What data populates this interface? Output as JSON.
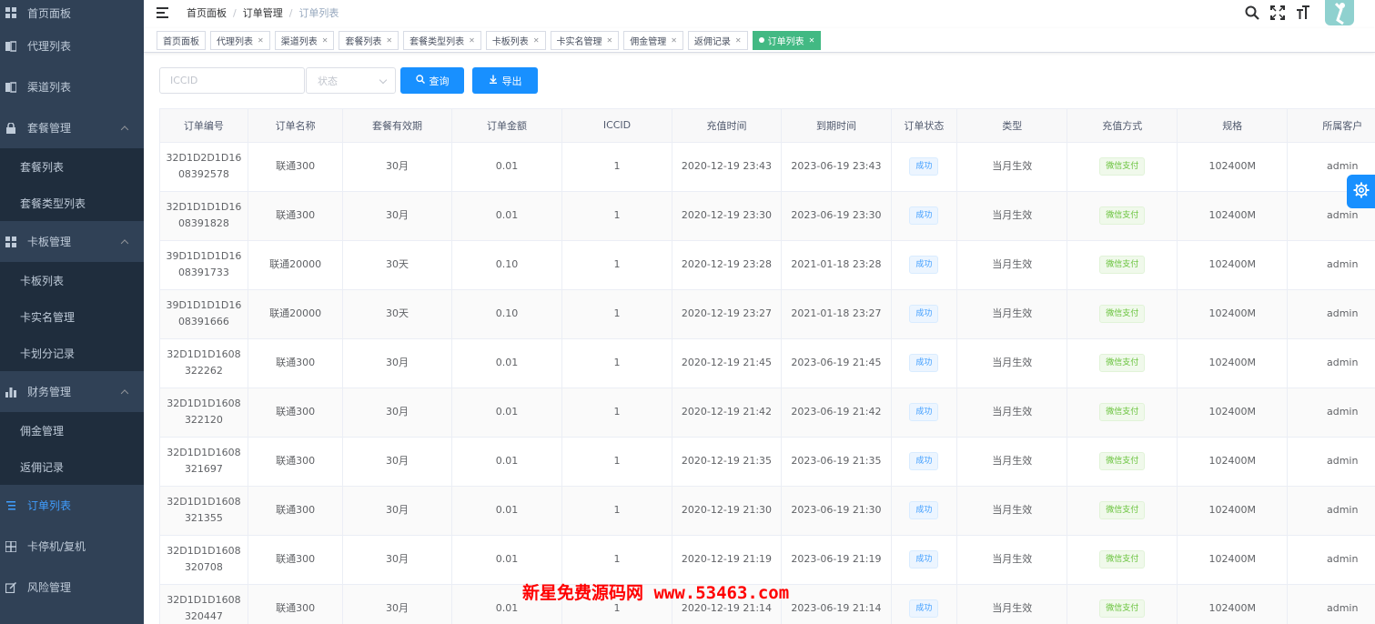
{
  "sidebar": {
    "items": [
      {
        "label": "首页面板",
        "icon": "dashboard-icon"
      },
      {
        "label": "代理列表",
        "icon": "agent-icon"
      },
      {
        "label": "渠道列表",
        "icon": "channel-icon"
      },
      {
        "label": "套餐管理",
        "icon": "package-icon"
      },
      {
        "label": "卡板管理",
        "icon": "card-grid-icon"
      },
      {
        "label": "财务管理",
        "icon": "bar-chart-icon"
      },
      {
        "label": "订单列表",
        "icon": "list-icon"
      },
      {
        "label": "卡停机/复机",
        "icon": "grid-icon"
      },
      {
        "label": "风险管理",
        "icon": "edit-icon"
      }
    ],
    "package_sub": [
      "套餐列表",
      "套餐类型列表"
    ],
    "card_sub": [
      "卡板列表",
      "卡实名管理",
      "卡划分记录"
    ],
    "finance_sub": [
      "佣金管理",
      "返佣记录"
    ]
  },
  "breadcrumb": [
    "首页面板",
    "订单管理",
    "订单列表"
  ],
  "tags": [
    "首页面板",
    "代理列表",
    "渠道列表",
    "套餐列表",
    "套餐类型列表",
    "卡板列表",
    "卡实名管理",
    "佣金管理",
    "返佣记录",
    "订单列表"
  ],
  "filter": {
    "iccid_placeholder": "ICCID",
    "status_placeholder": "状态",
    "search_label": "查询",
    "export_label": "导出"
  },
  "table": {
    "columns": [
      "订单编号",
      "订单名称",
      "套餐有效期",
      "订单金额",
      "ICCID",
      "充值时间",
      "到期时间",
      "订单状态",
      "类型",
      "充值方式",
      "规格",
      "所属客户"
    ],
    "rows": [
      {
        "order_no": [
          "32D1D2D1D16",
          "08392578"
        ],
        "name": "联通300",
        "validity": "30月",
        "amount": "0.01",
        "iccid": "1",
        "recharge_time": "2020-12-19 23:43",
        "expire_time": "2023-06-19 23:43",
        "status": "成功",
        "type": "当月生效",
        "method": "微信支付",
        "spec": "102400M",
        "customer": "admin"
      },
      {
        "order_no": [
          "32D1D1D1D16",
          "08391828"
        ],
        "name": "联通300",
        "validity": "30月",
        "amount": "0.01",
        "iccid": "1",
        "recharge_time": "2020-12-19 23:30",
        "expire_time": "2023-06-19 23:30",
        "status": "成功",
        "type": "当月生效",
        "method": "微信支付",
        "spec": "102400M",
        "customer": "admin"
      },
      {
        "order_no": [
          "39D1D1D1D16",
          "08391733"
        ],
        "name": "联通20000",
        "validity": "30天",
        "amount": "0.10",
        "iccid": "1",
        "recharge_time": "2020-12-19 23:28",
        "expire_time": "2021-01-18 23:28",
        "status": "成功",
        "type": "当月生效",
        "method": "微信支付",
        "spec": "102400M",
        "customer": "admin"
      },
      {
        "order_no": [
          "39D1D1D1D16",
          "08391666"
        ],
        "name": "联通20000",
        "validity": "30天",
        "amount": "0.10",
        "iccid": "1",
        "recharge_time": "2020-12-19 23:27",
        "expire_time": "2021-01-18 23:27",
        "status": "成功",
        "type": "当月生效",
        "method": "微信支付",
        "spec": "102400M",
        "customer": "admin"
      },
      {
        "order_no": [
          "32D1D1D1608",
          "322262"
        ],
        "name": "联通300",
        "validity": "30月",
        "amount": "0.01",
        "iccid": "1",
        "recharge_time": "2020-12-19 21:45",
        "expire_time": "2023-06-19 21:45",
        "status": "成功",
        "type": "当月生效",
        "method": "微信支付",
        "spec": "102400M",
        "customer": "admin"
      },
      {
        "order_no": [
          "32D1D1D1608",
          "322120"
        ],
        "name": "联通300",
        "validity": "30月",
        "amount": "0.01",
        "iccid": "1",
        "recharge_time": "2020-12-19 21:42",
        "expire_time": "2023-06-19 21:42",
        "status": "成功",
        "type": "当月生效",
        "method": "微信支付",
        "spec": "102400M",
        "customer": "admin"
      },
      {
        "order_no": [
          "32D1D1D1608",
          "321697"
        ],
        "name": "联通300",
        "validity": "30月",
        "amount": "0.01",
        "iccid": "1",
        "recharge_time": "2020-12-19 21:35",
        "expire_time": "2023-06-19 21:35",
        "status": "成功",
        "type": "当月生效",
        "method": "微信支付",
        "spec": "102400M",
        "customer": "admin"
      },
      {
        "order_no": [
          "32D1D1D1608",
          "321355"
        ],
        "name": "联通300",
        "validity": "30月",
        "amount": "0.01",
        "iccid": "1",
        "recharge_time": "2020-12-19 21:30",
        "expire_time": "2023-06-19 21:30",
        "status": "成功",
        "type": "当月生效",
        "method": "微信支付",
        "spec": "102400M",
        "customer": "admin"
      },
      {
        "order_no": [
          "32D1D1D1608",
          "320708"
        ],
        "name": "联通300",
        "validity": "30月",
        "amount": "0.01",
        "iccid": "1",
        "recharge_time": "2020-12-19 21:19",
        "expire_time": "2023-06-19 21:19",
        "status": "成功",
        "type": "当月生效",
        "method": "微信支付",
        "spec": "102400M",
        "customer": "admin"
      },
      {
        "order_no": [
          "32D1D1D1608",
          "320447"
        ],
        "name": "联通300",
        "validity": "30月",
        "amount": "0.01",
        "iccid": "1",
        "recharge_time": "2020-12-19 21:14",
        "expire_time": "2023-06-19 21:14",
        "status": "成功",
        "type": "当月生效",
        "method": "微信支付",
        "spec": "102400M",
        "customer": "admin"
      }
    ]
  },
  "watermark": "新星免费源码网 www.53463.com",
  "colors": {
    "sidebar_bg": "#304156",
    "submenu_bg": "#1f2d3d",
    "active": "#409eff",
    "primary_button": "#1890ff",
    "active_tag": "#42b983"
  }
}
